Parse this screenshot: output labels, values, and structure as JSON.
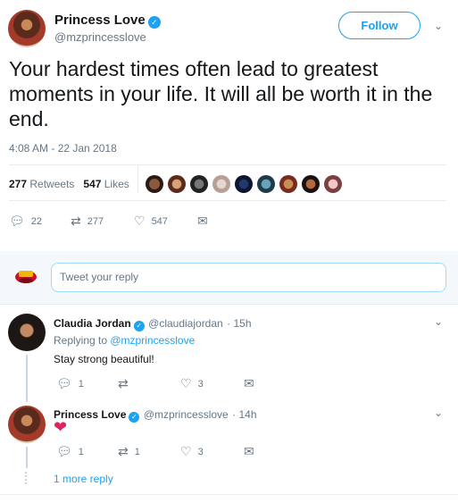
{
  "tweet": {
    "author_name": "Princess Love",
    "author_handle": "@mzprincesslove",
    "follow_label": "Follow",
    "text": "Your hardest times often lead to greatest moments in your life. It will all be worth it in the end.",
    "timestamp": "4:08 AM - 22 Jan 2018",
    "retweets_count": "277",
    "retweets_label": "Retweets",
    "likes_count": "547",
    "likes_label": "Likes",
    "actions": {
      "replies": "22",
      "retweets": "277",
      "likes": "547"
    }
  },
  "reply_box": {
    "placeholder": "Tweet your reply"
  },
  "replies": [
    {
      "name": "Claudia Jordan",
      "handle": "@claudiajordan",
      "time": "· 15h",
      "replying_prefix": "Replying to ",
      "replying_to": "@mzprincesslove",
      "text": "Stay strong beautiful!",
      "actions": {
        "replies": "1",
        "retweets": "",
        "likes": "3"
      }
    },
    {
      "name": "Princess Love",
      "handle": "@mzprincesslove",
      "time": "· 14h",
      "text": "❤",
      "actions": {
        "replies": "1",
        "retweets": "1",
        "likes": "3"
      }
    }
  ],
  "more_replies": "1 more reply",
  "icons": {
    "verified": "verified-badge-icon",
    "chevron": "chevron-down-icon",
    "reply": "reply-icon",
    "retweet": "retweet-icon",
    "like": "heart-icon",
    "dm": "envelope-icon"
  },
  "colors": {
    "accent": "#1da1f2",
    "muted": "#657786",
    "text": "#14171a",
    "heart": "#e0245e"
  }
}
